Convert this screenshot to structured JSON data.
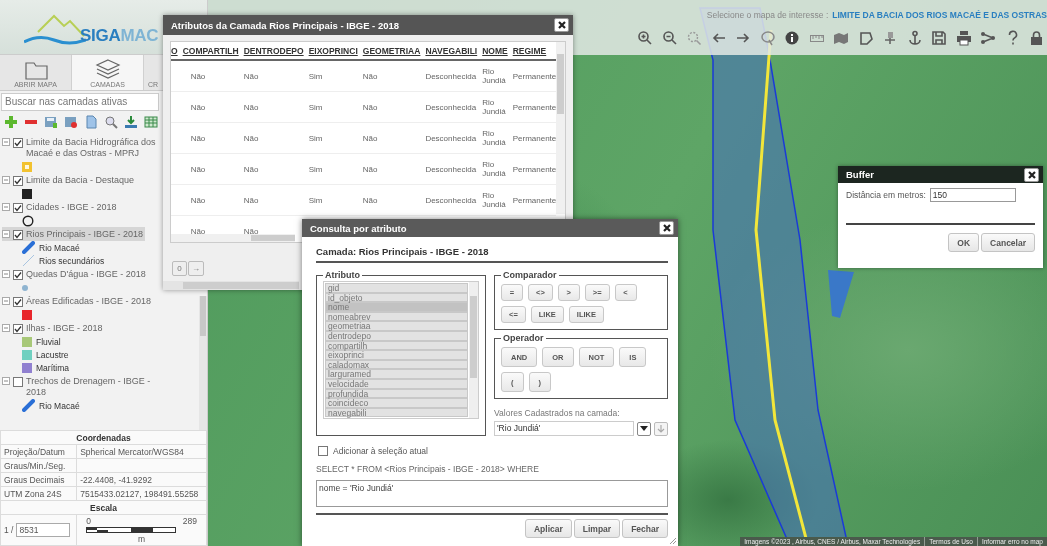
{
  "logo": {
    "text": "SIGA",
    "text_faded": "MAC"
  },
  "sidebar": {
    "tabs": [
      {
        "label": "ABRIR MAPA",
        "selected": false
      },
      {
        "label": "CAMADAS",
        "selected": true
      },
      {
        "label": "CR",
        "selected": false
      }
    ],
    "search": {
      "placeholder": "Buscar nas camadas ativas"
    },
    "layers": [
      {
        "label": "Limite da Bacia Hidrográfica dos Macaé e das Ostras - MPRJ",
        "checked": true,
        "expanded": true,
        "selected": false,
        "legend": [
          {
            "kind": "outline-square",
            "color": "#f2c230"
          }
        ]
      },
      {
        "label": "Limite da Bacia - Destaque",
        "checked": true,
        "expanded": true,
        "selected": false,
        "legend": [
          {
            "kind": "swatch",
            "color": "#222222"
          }
        ]
      },
      {
        "label": "Cidades - IBGE - 2018",
        "checked": true,
        "expanded": true,
        "selected": false,
        "legend": [
          {
            "kind": "ring",
            "color": "#222222"
          }
        ]
      },
      {
        "label": "Rios Principais - IBGE - 2018",
        "checked": true,
        "expanded": true,
        "selected": true,
        "legend": [
          {
            "kind": "line",
            "color": "#2a6fd6",
            "label": "Rio Macaé"
          },
          {
            "kind": "thin-line",
            "color": "#a8c4e0",
            "label": "Rios secundários"
          }
        ]
      },
      {
        "label": "Quedas D'água - IBGE - 2018",
        "checked": true,
        "expanded": true,
        "selected": false,
        "legend": [
          {
            "kind": "dot",
            "color": "#8fb4d0"
          }
        ]
      },
      {
        "label": "Áreas Edificadas - IBGE - 2018",
        "checked": true,
        "expanded": true,
        "selected": false,
        "legend": [
          {
            "kind": "swatch",
            "color": "#e8262b"
          }
        ]
      },
      {
        "label": "Ilhas - IBGE - 2018",
        "checked": true,
        "expanded": true,
        "selected": false,
        "legend": [
          {
            "kind": "swatch",
            "color": "#a8c878",
            "label": "Fluvial"
          },
          {
            "kind": "swatch",
            "color": "#70d0c0",
            "label": "Lacustre"
          },
          {
            "kind": "swatch",
            "color": "#9080d0",
            "label": "Marítima"
          }
        ]
      },
      {
        "label": "Trechos de Drenagem - IBGE - 2018",
        "checked": false,
        "expanded": true,
        "selected": false,
        "legend": [
          {
            "kind": "line",
            "color": "#2a6fd6",
            "label": "Rio Macaé"
          }
        ]
      }
    ],
    "coordinates": {
      "title": "Coordenadas",
      "rows": [
        {
          "label": "Projeção/Datum",
          "value": "Spherical Mercator/WGS84"
        },
        {
          "label": "Graus/Min./Seg."
        },
        {
          "label": "Graus Decimais",
          "value": "-22.4408, -41.9292"
        },
        {
          "label": "UTM Zona 24S",
          "value": "7515433.02127, 198491.55258"
        }
      ]
    },
    "scale": {
      "title": "Escala",
      "prefix": "1 /",
      "value": "8531",
      "bar_start": "0",
      "bar_end": "289",
      "unit": "m"
    }
  },
  "map": {
    "prompt": "Selecione o mapa de interesse :",
    "selected_map": "LIMITE DA BACIA DOS RIOS MACAÉ E DAS OSTRAS",
    "attribution": "Imagens ©2023 , Airbus, CNES / Airbus, Maxar Technologies",
    "links": [
      "Termos de Uso",
      "Informar erro no map"
    ]
  },
  "attributes_window": {
    "title": "Atributos da Camada Rios Principais - IBGE - 2018",
    "columns": [
      "O",
      "COMPARTILH",
      "DENTRODEPO",
      "EIXOPRINCI",
      "GEOMETRIAA",
      "NAVEGABILI",
      "NOME",
      "REGIME"
    ],
    "rows": [
      [
        "",
        "Não",
        "Não",
        "Sim",
        "Não",
        "Desconhecida",
        "Rio Jundiá",
        "Permanente"
      ],
      [
        "",
        "Não",
        "Não",
        "Sim",
        "Não",
        "Desconhecida",
        "Rio Jundiá",
        "Permanente"
      ],
      [
        "",
        "Não",
        "Não",
        "Sim",
        "Não",
        "Desconhecida",
        "Rio Jundiá",
        "Permanente"
      ],
      [
        "",
        "Não",
        "Não",
        "Sim",
        "Não",
        "Desconhecida",
        "Rio Jundiá",
        "Permanente"
      ],
      [
        "",
        "Não",
        "Não",
        "Sim",
        "Não",
        "Desconhecida",
        "Rio Jundiá",
        "Permanente"
      ],
      [
        "",
        "Não",
        "Não"
      ]
    ],
    "page": "0",
    "next": "→"
  },
  "query_dialog": {
    "title": "Consulta por atributo",
    "layer": "Camada: Rios Principais - IBGE - 2018",
    "attribute_legend": "Atributo",
    "attributes": [
      {
        "label": "gid",
        "selected": false
      },
      {
        "label": "id_objeto",
        "selected": false
      },
      {
        "label": "nome",
        "selected": true
      },
      {
        "label": "nomeabrev",
        "selected": false
      },
      {
        "label": "geometriaa",
        "selected": false
      },
      {
        "label": "dentrodepo",
        "selected": false
      },
      {
        "label": "compartilh",
        "selected": false
      },
      {
        "label": "eixoprinci",
        "selected": false
      },
      {
        "label": "caladomax",
        "selected": false
      },
      {
        "label": "larguramed",
        "selected": false
      },
      {
        "label": "velocidade",
        "selected": false
      },
      {
        "label": "profundida",
        "selected": false
      },
      {
        "label": "coincideco",
        "selected": false
      },
      {
        "label": "navegabili",
        "selected": false
      }
    ],
    "comparator_legend": "Comparador",
    "comparators": [
      "=",
      "<>",
      ">",
      ">=",
      "<",
      "<=",
      "LIKE",
      "ILIKE"
    ],
    "operator_legend": "Operador",
    "operators": [
      "AND",
      "OR",
      "NOT",
      "IS",
      "(",
      ")"
    ],
    "values_label": "Valores Cadastrados na camada:",
    "value": "'Rio Jundiá'",
    "add_to_selection": {
      "label": "Adicionar à seleção atual",
      "checked": false
    },
    "sql_prefix": "SELECT * FROM <Rios Principais - IBGE - 2018> WHERE",
    "sql": "nome = 'Rio Jundiá'",
    "buttons": [
      "Aplicar",
      "Limpar",
      "Fechar"
    ]
  },
  "buffer_dialog": {
    "title": "Buffer",
    "label": "Distância em metros:",
    "value": "150",
    "buttons": [
      "OK",
      "Cancelar"
    ]
  }
}
